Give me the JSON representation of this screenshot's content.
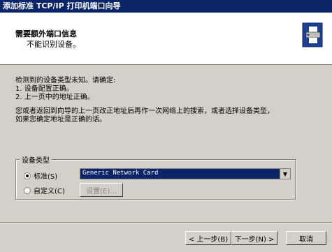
{
  "window": {
    "title": "添加标准 TCP/IP 打印机端口向导"
  },
  "header": {
    "title": "需要额外端口信息",
    "subtitle": "不能识别设备。",
    "icon": "printer-network-icon"
  },
  "body": {
    "line1": "检测到的设备类型未知。请确定:",
    "line2": "1. 设备配置正确。",
    "line3": "2. 上一页中的地址正确。",
    "line4": "您或者返回到向导的上一页改正地址后再作一次网络上的搜索，或者选择设备类型，",
    "line5": "如果您确定地址是正确的话。"
  },
  "device_type": {
    "group_label": "设备类型",
    "standard_label": "标准(S)",
    "standard_selected": "Generic Network Card",
    "custom_label": "自定义(C)",
    "settings_label": "设置(E)..."
  },
  "footer": {
    "back_label": "< 上一步(B)",
    "next_label": "下一步(N) >",
    "cancel_label": "取消"
  }
}
